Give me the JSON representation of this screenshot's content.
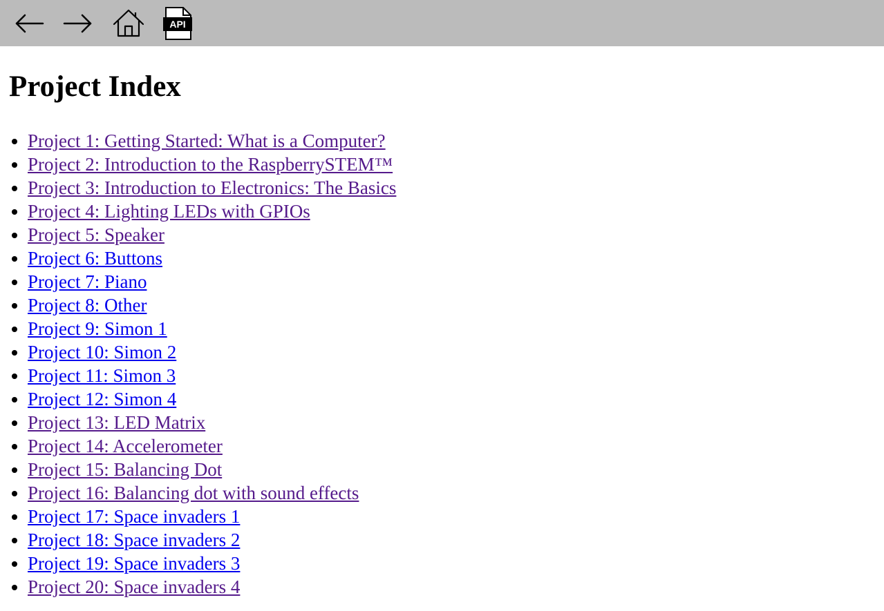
{
  "toolbar": {
    "back_icon": "arrow-left-icon",
    "forward_icon": "arrow-right-icon",
    "home_icon": "home-icon",
    "api_icon": "api-document-icon",
    "api_label": "API"
  },
  "page": {
    "title": "Project Index"
  },
  "colors": {
    "toolbar_bg": "#bbbbbb",
    "visited_link": "#551a8b",
    "unvisited_link": "#0000ee"
  },
  "projects": [
    {
      "label": "Project 1: Getting Started: What is a Computer?",
      "visited": true
    },
    {
      "label": "Project 2: Introduction to the RaspberrySTEM™ ",
      "visited": true
    },
    {
      "label": "Project 3: Introduction to Electronics: The Basics",
      "visited": true
    },
    {
      "label": "Project 4: Lighting LEDs with GPIOs",
      "visited": true
    },
    {
      "label": "Project 5: Speaker",
      "visited": true
    },
    {
      "label": "Project 6: Buttons",
      "visited": false
    },
    {
      "label": "Project 7: Piano",
      "visited": false
    },
    {
      "label": "Project 8: Other",
      "visited": false
    },
    {
      "label": "Project 9: Simon 1",
      "visited": false
    },
    {
      "label": "Project 10: Simon 2",
      "visited": false
    },
    {
      "label": "Project 11: Simon 3",
      "visited": false
    },
    {
      "label": "Project 12: Simon 4",
      "visited": false
    },
    {
      "label": "Project 13: LED Matrix",
      "visited": true
    },
    {
      "label": "Project 14: Accelerometer",
      "visited": true
    },
    {
      "label": "Project 15: Balancing Dot",
      "visited": true
    },
    {
      "label": "Project 16: Balancing dot with sound effects",
      "visited": true
    },
    {
      "label": "Project 17: Space invaders 1",
      "visited": false
    },
    {
      "label": "Project 18: Space invaders 2",
      "visited": false
    },
    {
      "label": "Project 19: Space invaders 3",
      "visited": false
    },
    {
      "label": "Project 20: Space invaders 4",
      "visited": true
    }
  ]
}
